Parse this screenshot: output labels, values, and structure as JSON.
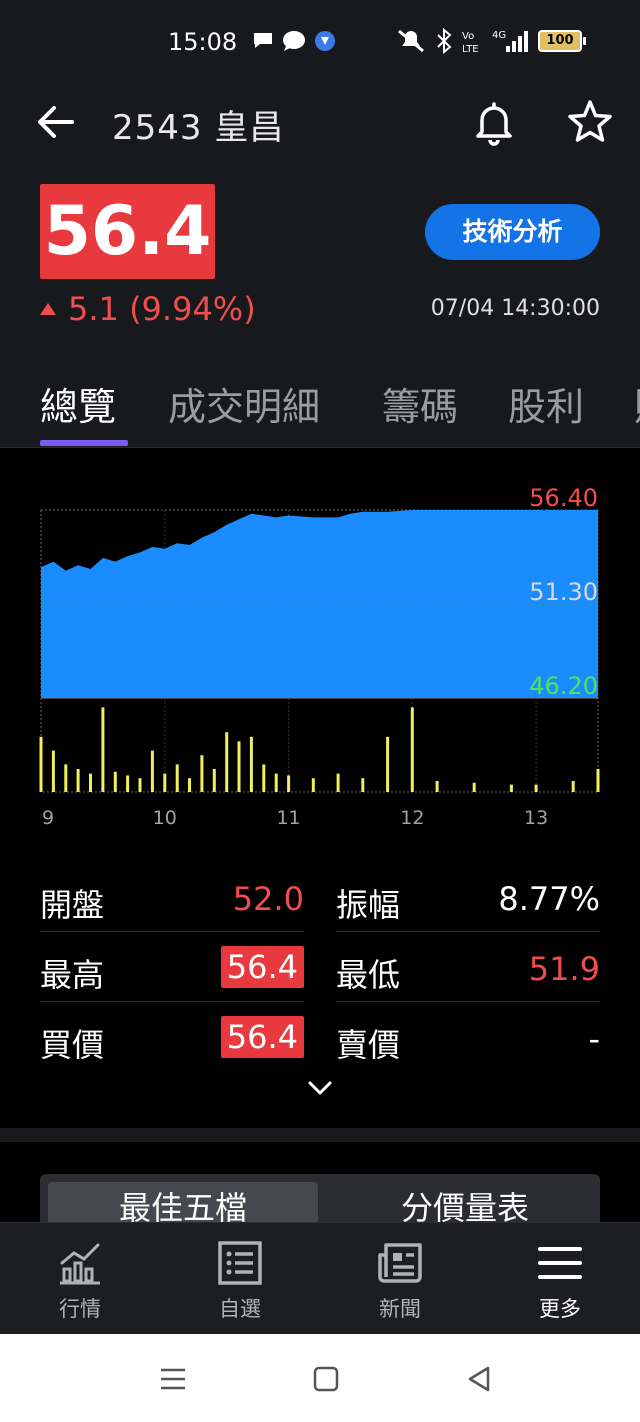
{
  "status_bar": {
    "time": "15:08",
    "battery": "100",
    "icons_left": [
      "chat-bubble-icon",
      "message-icon",
      "app-icon"
    ],
    "icons_right": [
      "mute-icon",
      "bluetooth-icon",
      "volte-icon",
      "signal-4g-icon"
    ]
  },
  "header": {
    "title": "2543 皇昌"
  },
  "quote": {
    "price": "56.4",
    "change": "5.1 (9.94%)",
    "timestamp": "07/04 14:30:00",
    "tech_button": "技術分析",
    "up_color": "#f04e4e",
    "price_bg": "#e8393e",
    "button_color": "#1473e6"
  },
  "tabs": [
    {
      "label": "總覽",
      "active": true
    },
    {
      "label": "成交明細",
      "active": false
    },
    {
      "label": "籌碼",
      "active": false
    },
    {
      "label": "股利",
      "active": false
    }
  ],
  "chart_data": {
    "type": "area",
    "x_ticks": [
      "9",
      "10",
      "11",
      "12",
      "13"
    ],
    "y_labels": {
      "top": "56.40",
      "mid": "51.30",
      "bottom": "46.20"
    },
    "ylim": [
      46.2,
      56.4
    ],
    "price_series": [
      {
        "t": 9.0,
        "v": 53.3
      },
      {
        "t": 9.1,
        "v": 53.6
      },
      {
        "t": 9.2,
        "v": 53.1
      },
      {
        "t": 9.3,
        "v": 53.4
      },
      {
        "t": 9.4,
        "v": 53.2
      },
      {
        "t": 9.5,
        "v": 53.8
      },
      {
        "t": 9.6,
        "v": 53.6
      },
      {
        "t": 9.7,
        "v": 53.9
      },
      {
        "t": 9.8,
        "v": 54.1
      },
      {
        "t": 9.9,
        "v": 54.4
      },
      {
        "t": 10.0,
        "v": 54.3
      },
      {
        "t": 10.1,
        "v": 54.6
      },
      {
        "t": 10.2,
        "v": 54.5
      },
      {
        "t": 10.3,
        "v": 54.9
      },
      {
        "t": 10.4,
        "v": 55.2
      },
      {
        "t": 10.5,
        "v": 55.6
      },
      {
        "t": 10.6,
        "v": 55.9
      },
      {
        "t": 10.7,
        "v": 56.2
      },
      {
        "t": 10.8,
        "v": 56.1
      },
      {
        "t": 10.9,
        "v": 56.0
      },
      {
        "t": 11.0,
        "v": 56.1
      },
      {
        "t": 11.2,
        "v": 56.0
      },
      {
        "t": 11.4,
        "v": 56.0
      },
      {
        "t": 11.5,
        "v": 56.2
      },
      {
        "t": 11.6,
        "v": 56.3
      },
      {
        "t": 11.8,
        "v": 56.3
      },
      {
        "t": 12.0,
        "v": 56.4
      },
      {
        "t": 12.5,
        "v": 56.4
      },
      {
        "t": 13.0,
        "v": 56.4
      },
      {
        "t": 13.5,
        "v": 56.4
      }
    ],
    "volume_series": [
      {
        "t": 9.0,
        "v": 60
      },
      {
        "t": 9.1,
        "v": 45
      },
      {
        "t": 9.2,
        "v": 30
      },
      {
        "t": 9.3,
        "v": 25
      },
      {
        "t": 9.4,
        "v": 20
      },
      {
        "t": 9.5,
        "v": 92
      },
      {
        "t": 9.6,
        "v": 22
      },
      {
        "t": 9.7,
        "v": 18
      },
      {
        "t": 9.8,
        "v": 15
      },
      {
        "t": 9.9,
        "v": 45
      },
      {
        "t": 10.0,
        "v": 20
      },
      {
        "t": 10.1,
        "v": 30
      },
      {
        "t": 10.2,
        "v": 15
      },
      {
        "t": 10.3,
        "v": 40
      },
      {
        "t": 10.4,
        "v": 25
      },
      {
        "t": 10.5,
        "v": 65
      },
      {
        "t": 10.6,
        "v": 55
      },
      {
        "t": 10.7,
        "v": 60
      },
      {
        "t": 10.8,
        "v": 30
      },
      {
        "t": 10.9,
        "v": 20
      },
      {
        "t": 11.0,
        "v": 18
      },
      {
        "t": 11.2,
        "v": 15
      },
      {
        "t": 11.4,
        "v": 20
      },
      {
        "t": 11.6,
        "v": 15
      },
      {
        "t": 11.8,
        "v": 60
      },
      {
        "t": 12.0,
        "v": 92
      },
      {
        "t": 12.2,
        "v": 12
      },
      {
        "t": 12.5,
        "v": 10
      },
      {
        "t": 12.8,
        "v": 8
      },
      {
        "t": 13.0,
        "v": 8
      },
      {
        "t": 13.3,
        "v": 12
      },
      {
        "t": 13.5,
        "v": 25
      }
    ],
    "area_color": "#1a8cff",
    "volume_color": "#f2ef5a"
  },
  "stats": {
    "open_label": "開盤",
    "open_value": "52.0",
    "amplitude_label": "振幅",
    "amplitude_value": "8.77%",
    "high_label": "最高",
    "high_value": "56.4",
    "low_label": "最低",
    "low_value": "51.9",
    "bid_label": "買價",
    "bid_value": "56.4",
    "ask_label": "賣價",
    "ask_value": "-"
  },
  "order_book": {
    "tab_best_five": "最佳五檔",
    "tab_price_volume": "分價量表"
  },
  "bottom_nav": [
    {
      "label": "行情",
      "icon": "market-chart-icon",
      "active": false
    },
    {
      "label": "自選",
      "icon": "watchlist-icon",
      "active": false
    },
    {
      "label": "新聞",
      "icon": "news-icon",
      "active": false
    },
    {
      "label": "更多",
      "icon": "hamburger-menu-icon",
      "active": true
    }
  ]
}
